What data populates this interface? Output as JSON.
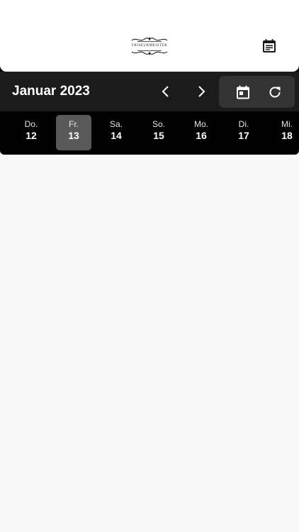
{
  "header": {
    "logo_text": "FRISEURMEISTER",
    "logo_icon": "ornament-logo",
    "notes_icon": "notes-icon"
  },
  "toolbar": {
    "month_title": "Januar 2023",
    "prev_icon": "chevron-left-icon",
    "next_icon": "chevron-right-icon",
    "today_icon": "calendar-today-icon",
    "refresh_icon": "refresh-icon"
  },
  "days": [
    {
      "name": "Do.",
      "num": "12",
      "selected": false
    },
    {
      "name": "Fr.",
      "num": "13",
      "selected": true
    },
    {
      "name": "Sa.",
      "num": "14",
      "selected": false
    },
    {
      "name": "So.",
      "num": "15",
      "selected": false
    },
    {
      "name": "Mo.",
      "num": "16",
      "selected": false
    },
    {
      "name": "Di.",
      "num": "17",
      "selected": false
    },
    {
      "name": "Mi.",
      "num": "18",
      "selected": false
    }
  ],
  "colors": {
    "header_bg": "#ffffff",
    "toolbar_bg": "#1b1b1b",
    "strip_bg": "#000000",
    "selected_day_bg": "#595959",
    "action_group_bg": "#333333",
    "content_bg": "#f8f8f8"
  }
}
